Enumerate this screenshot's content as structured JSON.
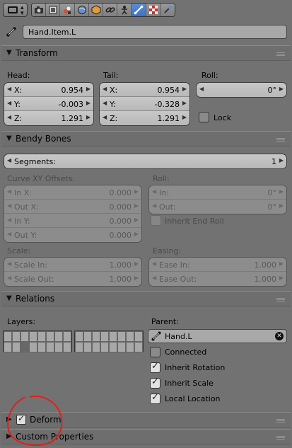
{
  "toolbar": {
    "context_tabs": [
      "render",
      "render-layers",
      "scene",
      "world",
      "object",
      "constraints",
      "data",
      "bone",
      "bone-constraints",
      "texture"
    ],
    "active_tab": "bone"
  },
  "bone": {
    "name": "Hand.Item.L"
  },
  "transform": {
    "title": "Transform",
    "head_label": "Head:",
    "tail_label": "Tail:",
    "roll_label": "Roll:",
    "head": [
      {
        "k": "X:",
        "v": "0.954"
      },
      {
        "k": "Y:",
        "v": "-0.003"
      },
      {
        "k": "Z:",
        "v": "1.291"
      }
    ],
    "tail": [
      {
        "k": "X:",
        "v": "0.954"
      },
      {
        "k": "Y:",
        "v": "-0.328"
      },
      {
        "k": "Z:",
        "v": "1.291"
      }
    ],
    "roll_value": "0°",
    "lock_label": "Lock"
  },
  "bendy_bones": {
    "title": "Bendy Bones",
    "segments_label": "Segments:",
    "segments_value": "1",
    "curve_label": "Curve XY Offsets:",
    "curve": [
      {
        "k": "In X:",
        "v": "0.000"
      },
      {
        "k": "Out X:",
        "v": "0.000"
      },
      {
        "k": "In Y:",
        "v": "0.000"
      },
      {
        "k": "Out Y:",
        "v": "0.000"
      }
    ],
    "roll_label": "Roll:",
    "roll": [
      {
        "k": "In:",
        "v": "0°"
      },
      {
        "k": "Out:",
        "v": "0°"
      }
    ],
    "inherit_end_roll": "Inherit End Roll",
    "scale_label": "Scale:",
    "scale": [
      {
        "k": "Scale In:",
        "v": "1.000"
      },
      {
        "k": "Scale Out:",
        "v": "1.000"
      }
    ],
    "easing_label": "Easing:",
    "easing": [
      {
        "k": "Ease In:",
        "v": "1.000"
      },
      {
        "k": "Ease Out:",
        "v": "1.000"
      }
    ]
  },
  "relations": {
    "title": "Relations",
    "layers_label": "Layers:",
    "parent_label": "Parent:",
    "parent_value": "Hand.L",
    "connected": "Connected",
    "inherit_rotation": "Inherit Rotation",
    "inherit_scale": "Inherit Scale",
    "local_location": "Local Location"
  },
  "deform": {
    "title": "Deform"
  },
  "custom_properties": {
    "title": "Custom Properties"
  },
  "colors": {
    "background": "#727272",
    "field": "#c0c0c0",
    "active_tab": "#5680c2",
    "annotation": "#e0201a"
  }
}
